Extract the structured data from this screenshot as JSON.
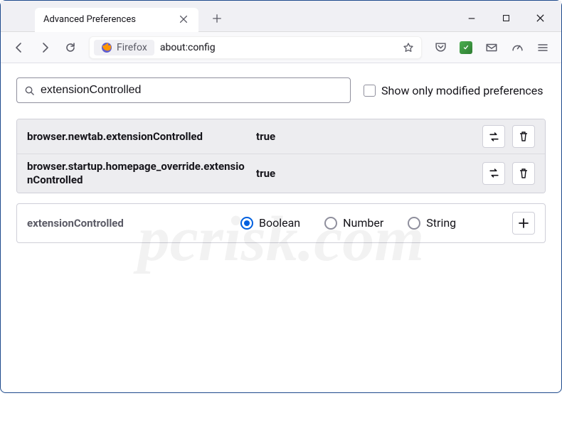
{
  "window": {
    "tab_title": "Advanced Preferences"
  },
  "urlbar": {
    "identity_label": "Firefox",
    "url": "about:config"
  },
  "search": {
    "value": "extensionControlled",
    "checkbox_label": "Show only modified preferences"
  },
  "prefs": [
    {
      "name": "browser.newtab.extensionControlled",
      "value": "true"
    },
    {
      "name": "browser.startup.homepage_override.extensionControlled",
      "value": "true"
    }
  ],
  "add": {
    "name": "extensionControlled",
    "options": [
      "Boolean",
      "Number",
      "String"
    ],
    "selected": 0
  },
  "watermark": "pcrisk.com"
}
